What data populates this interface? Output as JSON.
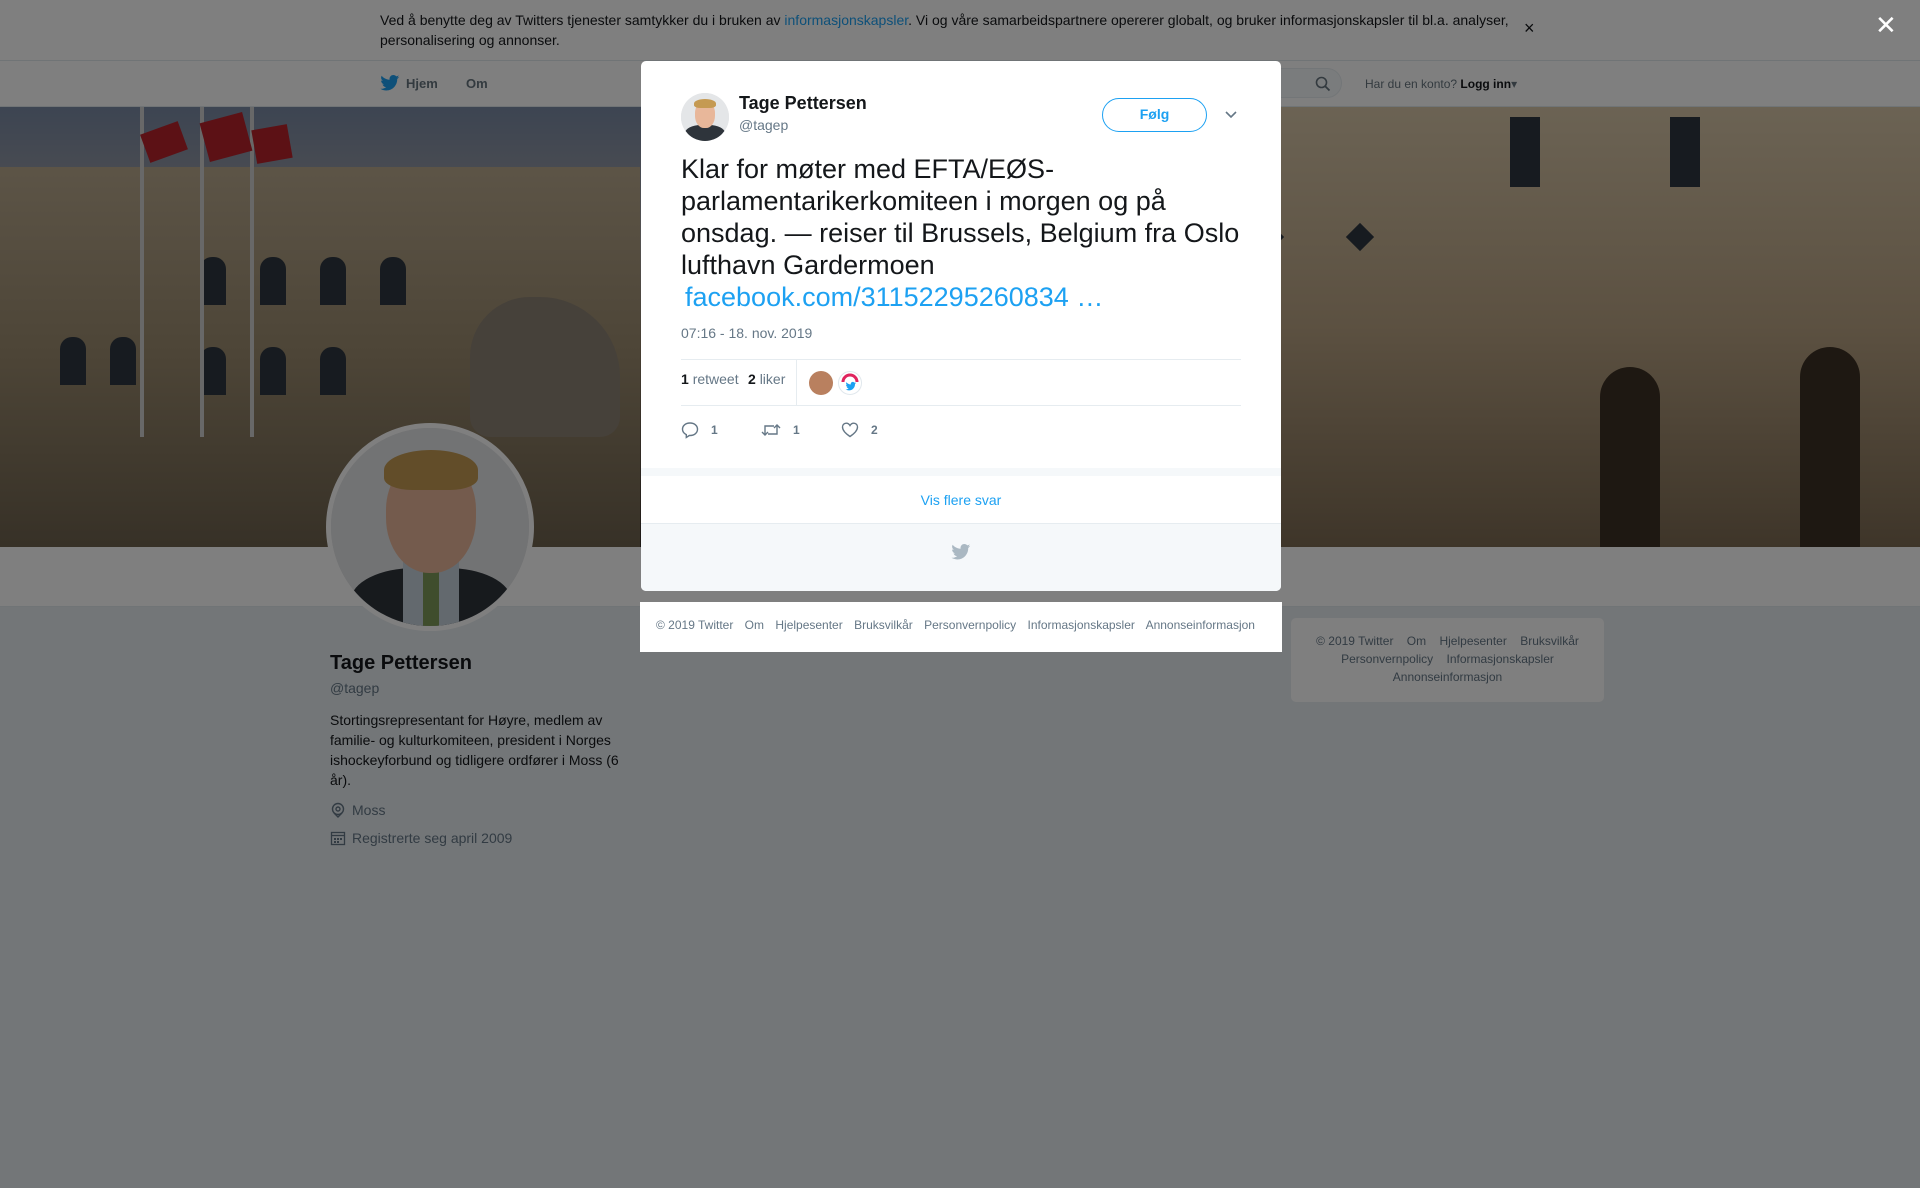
{
  "cookie_banner": {
    "text_before": "Ved å benytte deg av Twitters tjenester samtykker du i bruken av ",
    "link": "informasjonskapsler",
    "text_after": ". Vi og våre samarbeidspartnere opererer globalt, og bruker informasjonskapsler til bl.a. analyser, personalisering og annonser.",
    "close": "×"
  },
  "nav": {
    "home": "Hjem",
    "about": "Om",
    "login_prompt": "Har du en konto?",
    "login": "Logg inn",
    "login_caret": "▾"
  },
  "profile": {
    "name": "Tage Pettersen",
    "handle": "@tagep",
    "bio": "Stortingsrepresentant for Høyre, medlem av familie- og kulturkomiteen, president i Norges ishockeyforbund og tidligere ordfører i Moss (6 år).",
    "location": "Moss",
    "joined": "Registrerte seg april 2009"
  },
  "right_footer": {
    "items": [
      "© 2019 Twitter",
      "Om",
      "Hjelpesenter",
      "Bruksvilkår",
      "Personvernpolicy",
      "Informasjonskapsler",
      "Annonseinformasjon"
    ]
  },
  "overlay": {
    "close": "✕"
  },
  "tweet": {
    "author_name": "Tage Pettersen",
    "author_handle": "@tagep",
    "follow_label": "Følg",
    "text": "Klar for møter med EFTA/EØS-parlamentarikerkomiteen i morgen og på onsdag. — reiser til Brussels, Belgium fra Oslo lufthavn Gardermoen",
    "link": "facebook.com/31152295260834 …",
    "timestamp": "07:16 - 18. nov. 2019",
    "retweet_count": "1",
    "retweet_label": "retweet",
    "like_count": "2",
    "like_label": "liker",
    "actions": {
      "reply": "1",
      "retweet": "1",
      "like": "2"
    },
    "more_replies": "Vis flere svar"
  },
  "modal_footer": {
    "items": [
      "© 2019 Twitter",
      "Om",
      "Hjelpesenter",
      "Bruksvilkår",
      "Personvernpolicy",
      "Informasjonskapsler",
      "Annonseinformasjon"
    ]
  },
  "colors": {
    "accent": "#1da1f2",
    "text": "#14171a",
    "muted": "#657786",
    "overlay": "rgba(0,0,0,0.5)"
  },
  "icons": [
    "twitter-bird-icon",
    "search-icon",
    "close-icon",
    "chevron-down-icon",
    "reply-icon",
    "retweet-icon",
    "heart-icon",
    "location-icon",
    "calendar-icon"
  ]
}
